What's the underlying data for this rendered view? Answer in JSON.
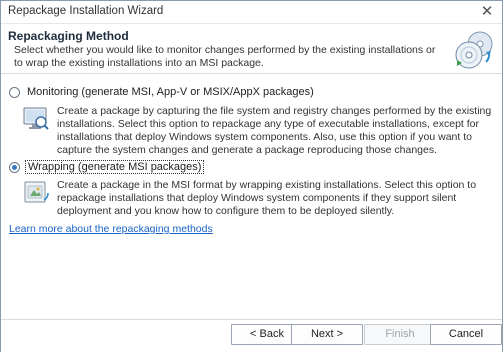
{
  "window": {
    "title": "Repackage Installation Wizard",
    "close_glyph": "✕"
  },
  "header": {
    "title": "Repackaging Method",
    "description": "Select whether you would like to monitor changes performed by the existing installations or to wrap the existing installations into an MSI package.",
    "icon": "repackage-discs-icon"
  },
  "options": [
    {
      "label": "Monitoring (generate MSI, App-V or MSIX/AppX packages)",
      "selected": false,
      "icon": "monitor-magnifier-icon",
      "description": "Create a package by capturing the file system and registry changes performed by the existing installations. Select this option to repackage any type of executable installations, except for installations that deploy Windows system components. Also, use this option if you want to capture the system changes and generate a package reproducing those changes."
    },
    {
      "label": "Wrapping (generate MSI packages)",
      "selected": true,
      "icon": "package-wrap-icon",
      "description": "Create a package in the MSI format by wrapping existing installations. Select this option to repackage installations that deploy Windows system components if they support silent deployment and you know how to configure them to be deployed silently."
    }
  ],
  "learn_more": "Learn more about the repackaging methods",
  "footer": {
    "back": "< Back",
    "next": "Next >",
    "finish": "Finish",
    "cancel": "Cancel"
  },
  "colors": {
    "accent": "#3a78c4",
    "link": "#1a63c6",
    "disabled_text": "#9ea4ab"
  }
}
